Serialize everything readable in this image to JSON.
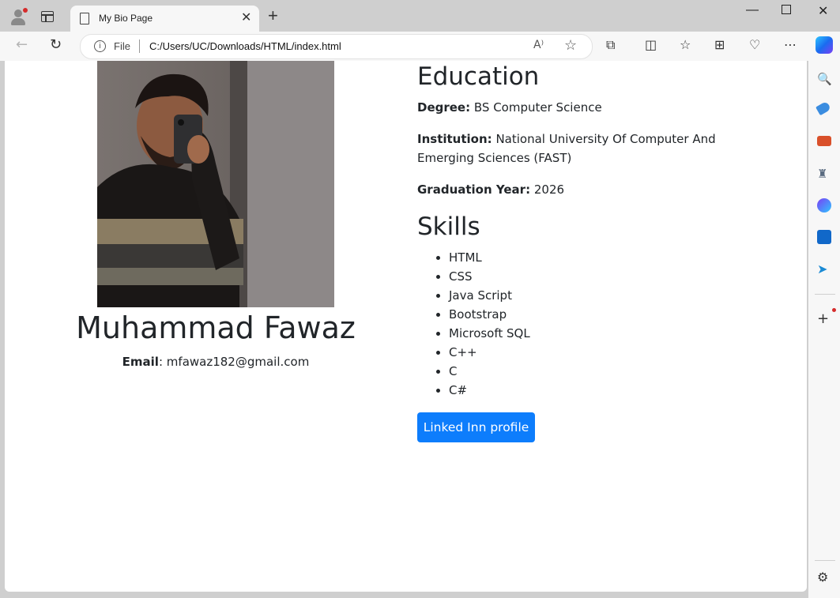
{
  "browser": {
    "tab_title": "My Bio Page",
    "address_scheme": "File",
    "url": "C:/Users/UC/Downloads/HTML/index.html"
  },
  "profile": {
    "name": "Muhammad Fawaz",
    "email_label": "Email",
    "email": "mfawaz182@gmail.com"
  },
  "education": {
    "heading": "Education",
    "degree_label": "Degree:",
    "degree": "BS Computer Science",
    "institution_label": "Institution:",
    "institution": "National University Of Computer And Emerging Sciences (FAST)",
    "graduation_label": "Graduation Year:",
    "graduation_year": "2026"
  },
  "skills": {
    "heading": "Skills",
    "items": [
      "HTML",
      "CSS",
      "Java Script",
      "Bootstrap",
      "Microsoft SQL",
      "C++",
      "C",
      "C#"
    ]
  },
  "linkedin_button": "Linked Inn profile",
  "colors": {
    "button": "#0d7dfc",
    "text": "#212529"
  }
}
